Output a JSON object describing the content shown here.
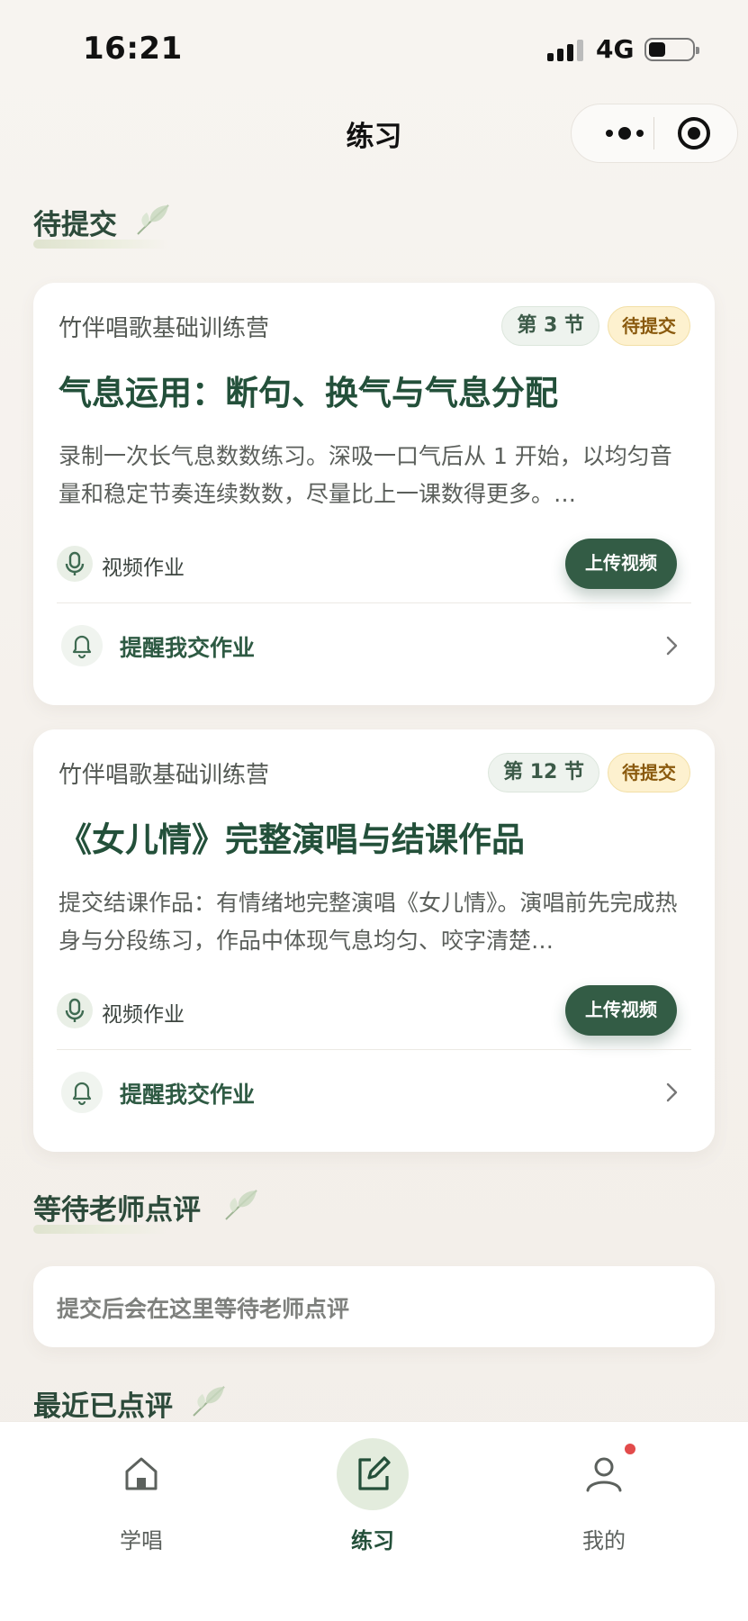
{
  "status_bar": {
    "time": "16:21",
    "network": "4G"
  },
  "nav": {
    "title": "练习"
  },
  "sections": {
    "pending": "待提交",
    "awaiting_review": "等待老师点评",
    "recent_reviewed": "最近已点评"
  },
  "assignments": [
    {
      "course": "竹伴唱歌基础训练营",
      "lesson": "第 3 节",
      "status": "待提交",
      "title": "气息运用：断句、换气与气息分配",
      "description": "录制一次长气息数数练习。深吸一口气后从 1 开始，以均匀音量和稳定节奏连续数数，尽量比上一课数得更多。…",
      "type": "视频作业",
      "action": "上传视频",
      "remind": "提醒我交作业"
    },
    {
      "course": "竹伴唱歌基础训练营",
      "lesson": "第 12 节",
      "status": "待提交",
      "title": "《女儿情》完整演唱与结课作品",
      "description": "提交结课作品：有情绪地完整演唱《女儿情》。演唱前先完成热身与分段练习，作品中体现气息均匀、咬字清楚…",
      "type": "视频作业",
      "action": "上传视频",
      "remind": "提醒我交作业"
    }
  ],
  "review_empty": "提交后会在这里等待老师点评",
  "tabbar": {
    "items": [
      {
        "label": "学唱",
        "icon": "home-icon",
        "active": false
      },
      {
        "label": "练习",
        "icon": "edit-icon",
        "active": true
      },
      {
        "label": "我的",
        "icon": "user-icon",
        "active": false,
        "badge": true
      }
    ]
  },
  "colors": {
    "primary": "#335c45",
    "title_green": "#23503a",
    "pending_tag_bg": "#fdf1cf",
    "pending_tag_text": "#8a5a0e",
    "badge_red": "#e24b4b"
  }
}
